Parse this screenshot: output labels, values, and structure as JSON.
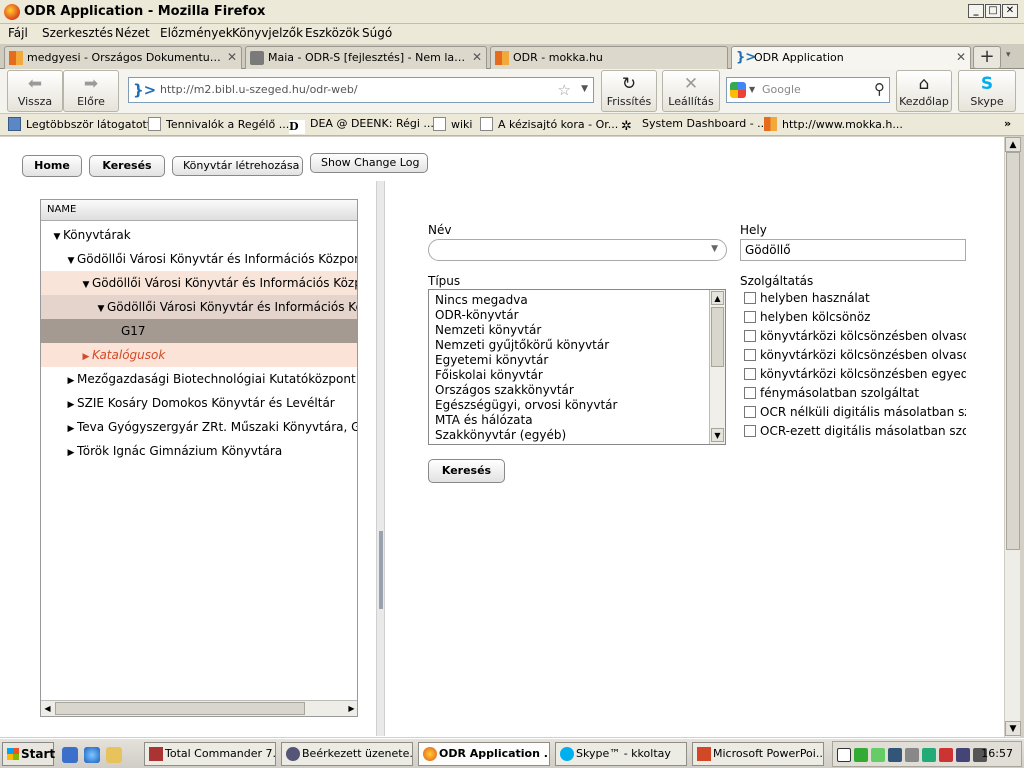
{
  "window": {
    "title": "ODR Application - Mozilla Firefox"
  },
  "menu": [
    "Fájl",
    "Szerkesztés",
    "Nézet",
    "Előzmények",
    "Könyvjelzők",
    "Eszközök",
    "Súgó"
  ],
  "tabs": [
    {
      "label": "medgyesi - Országos Dokumentumellát..."
    },
    {
      "label": "Maia - ODR-S [fejlesztés] - Nem latszik ..."
    },
    {
      "label": "ODR - mokka.hu"
    },
    {
      "label": "ODR Application"
    }
  ],
  "nav": {
    "back": "Vissza",
    "forward": "Előre",
    "url": "http://m2.bibl.u-szeged.hu/odr-web/",
    "reload": "Frissítés",
    "stop": "Leállítás",
    "search_placeholder": "Google",
    "home": "Kezdőlap",
    "skype": "Skype"
  },
  "bookmarks": [
    "Legtöbbször látogatott",
    "Tennivalók a Regélő ...",
    "DEA @ DEENK: Régi ...",
    "wiki",
    "A kézisajtó kora - Or...",
    "System Dashboard - ...",
    "http://www.mokka.h..."
  ],
  "app": {
    "buttons": {
      "home": "Home",
      "search": "Keresés",
      "create": "Könyvtár létrehozása",
      "changelog": "Show Change Log"
    },
    "tree": {
      "header": "NAME",
      "rows": [
        {
          "label": "Könyvtárak"
        },
        {
          "label": "Gödöllői Városi Könyvtár és Információs Központ, G"
        },
        {
          "label": "Gödöllői Városi Könyvtár és Információs Központ"
        },
        {
          "label": "Gödöllői Városi Könyvtár és Információs Közpo"
        },
        {
          "label": "G17"
        },
        {
          "label": "Katalógusok"
        },
        {
          "label": "Mezőgazdasági Biotechnológiai Kutatóközpont Köny"
        },
        {
          "label": "SZIE Kosáry Domokos Könyvtár és Levéltár"
        },
        {
          "label": "Teva Gyógyszergyár ZRt. Műszaki Könyvtára, Gödöllő"
        },
        {
          "label": "Török Ignác Gimnázium Könyvtára"
        }
      ]
    },
    "form": {
      "nev_label": "Név",
      "nev_value": "",
      "hely_label": "Hely",
      "hely_value": "Gödöllő",
      "tipus_label": "Típus",
      "tipus_options": [
        "Nincs megadva",
        "ODR-könyvtár",
        "Nemzeti könyvtár",
        "Nemzeti gyűjtőkörű könyvtár",
        "Egyetemi könyvtár",
        "Főiskolai könyvtár",
        "Országos szakkönyvtár",
        "Egészségügyi, orvosi könyvtár",
        "MTA és hálózata",
        "Szakkönyvtár (egyéb)"
      ],
      "szolg_label": "Szolgáltatás",
      "services": [
        "helyben használat",
        "helyben kölcsönöz",
        "könyvtárközi kölcsönzésben olvasói kö",
        "könyvtárközi kölcsönzésben olvasóter",
        "könyvtárközi kölcsönzésben egyedi elk",
        "fénymásolatban szolgáltat",
        "OCR nélküli digitális másolatban szolg",
        "OCR-ezett digitális másolatban szolga"
      ],
      "submit": "Keresés"
    }
  },
  "taskbar": {
    "start": "Start",
    "tasks": [
      "Total Commander 7....",
      "Beérkezett üzenete...",
      "ODR Application ...",
      "Skype™ - kkoltay",
      "Microsoft PowerPoi..."
    ],
    "clock": "16:57"
  }
}
